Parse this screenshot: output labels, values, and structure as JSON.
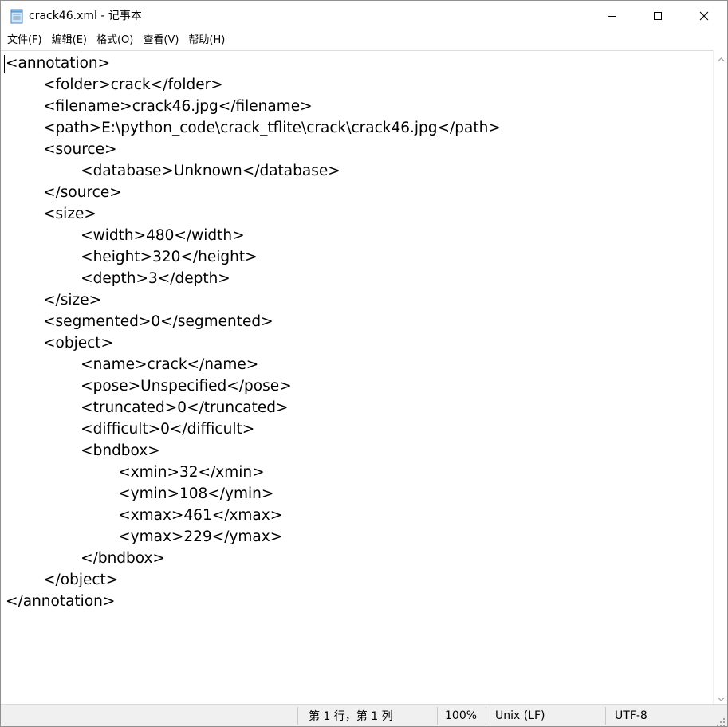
{
  "window": {
    "title": "crack46.xml - 记事本",
    "icon": "notepad-icon"
  },
  "controls": {
    "minimize_icon": "minimize-icon",
    "maximize_icon": "maximize-icon",
    "close_icon": "close-icon"
  },
  "menu": [
    {
      "label": "文件(F)"
    },
    {
      "label": "编辑(E)"
    },
    {
      "label": "格式(O)"
    },
    {
      "label": "查看(V)"
    },
    {
      "label": "帮助(H)"
    }
  ],
  "editor": {
    "content": "<annotation>\n\t<folder>crack</folder>\n\t<filename>crack46.jpg</filename>\n\t<path>E:\\python_code\\crack_tflite\\crack\\crack46.jpg</path>\n\t<source>\n\t\t<database>Unknown</database>\n\t</source>\n\t<size>\n\t\t<width>480</width>\n\t\t<height>320</height>\n\t\t<depth>3</depth>\n\t</size>\n\t<segmented>0</segmented>\n\t<object>\n\t\t<name>crack</name>\n\t\t<pose>Unspecified</pose>\n\t\t<truncated>0</truncated>\n\t\t<difficult>0</difficult>\n\t\t<bndbox>\n\t\t\t<xmin>32</xmin>\n\t\t\t<ymin>108</ymin>\n\t\t\t<xmax>461</xmax>\n\t\t\t<ymax>229</ymax>\n\t\t</bndbox>\n\t</object>\n</annotation>"
  },
  "status": {
    "position": "第 1 行，第 1 列",
    "zoom": "100%",
    "line_ending": "Unix (LF)",
    "encoding": "UTF-8"
  }
}
